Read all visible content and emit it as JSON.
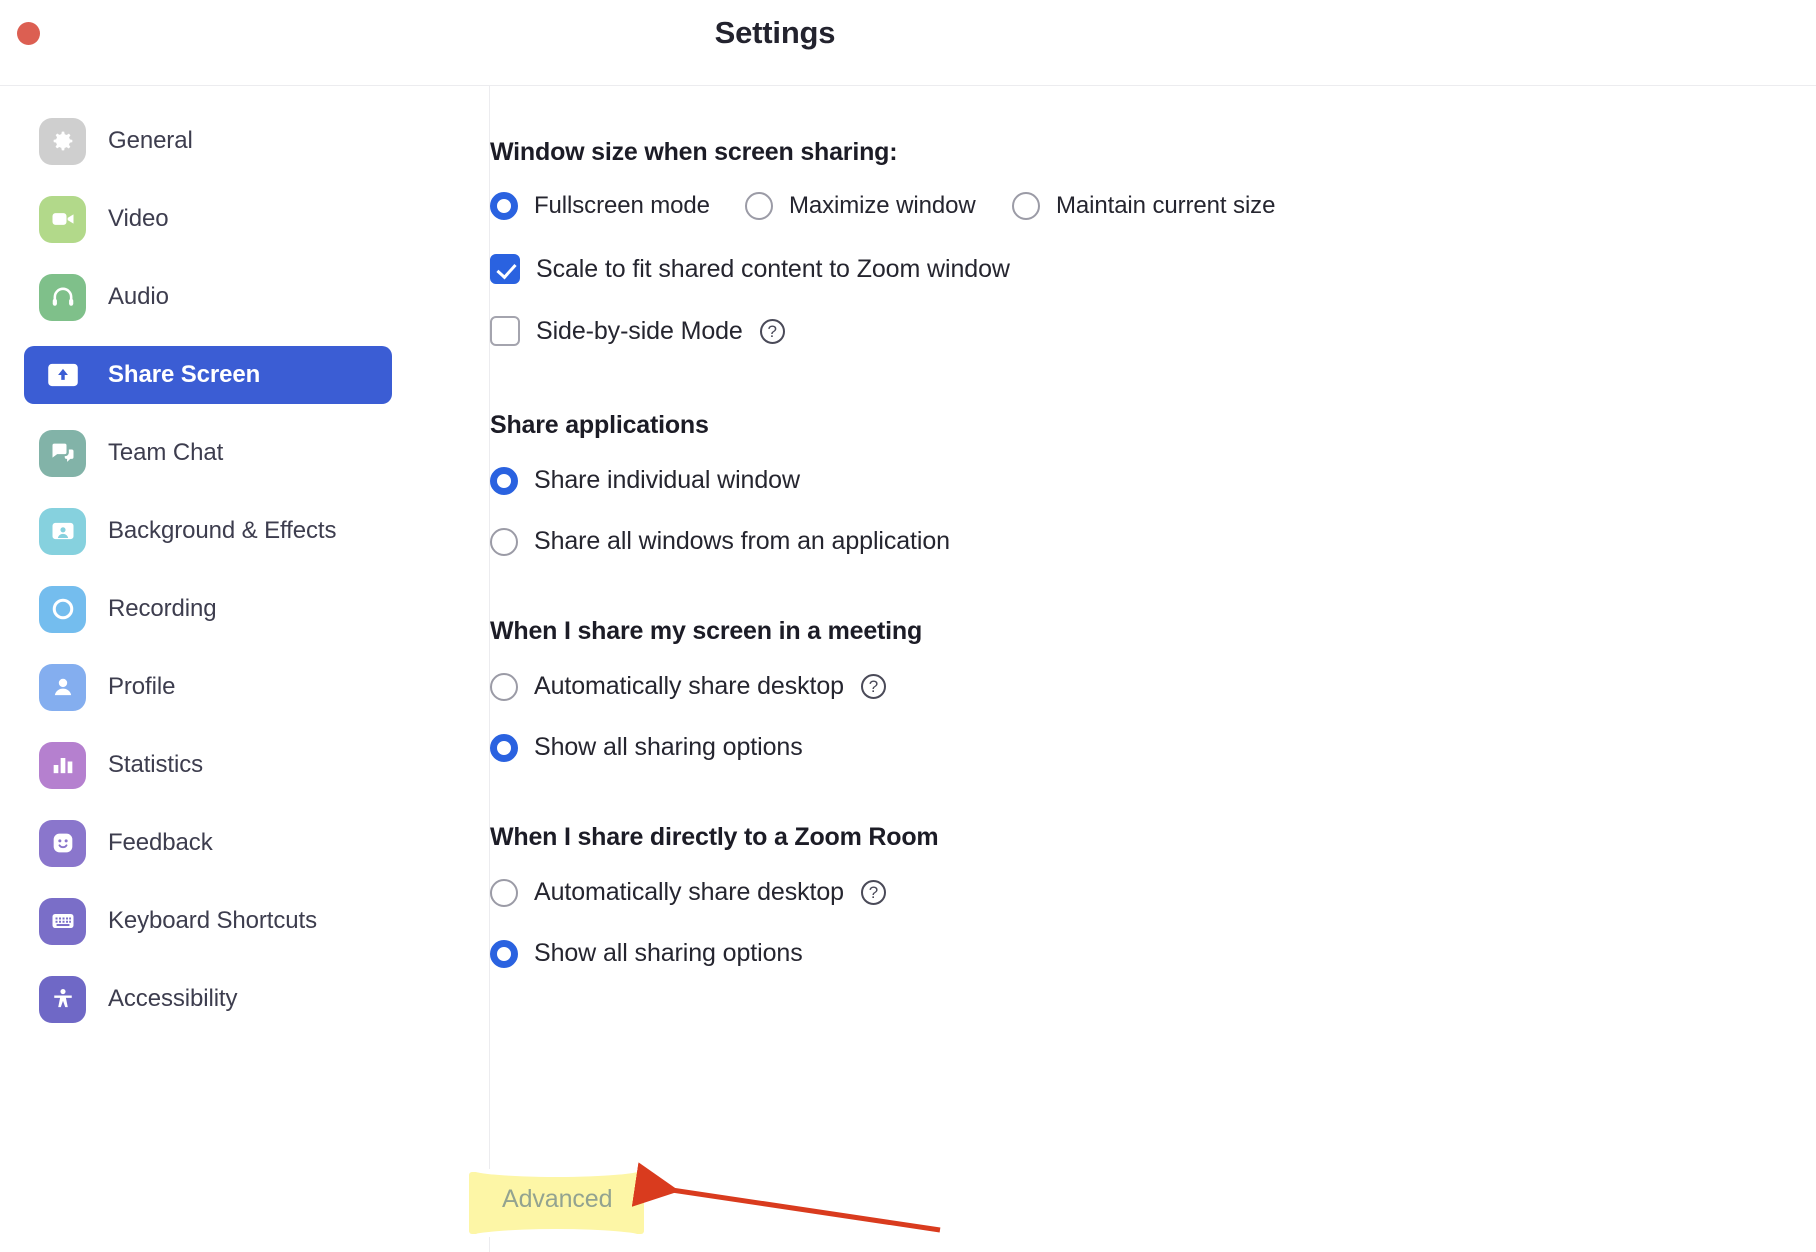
{
  "window": {
    "title": "Settings",
    "close_button_label": "Close",
    "close_color": "#dc5f52"
  },
  "theme": {
    "accent_blue": "#2a62e0",
    "active_nav_blue": "#3b5dd4",
    "highlight_yellow": "#fdf6a6",
    "annotation_red": "#d93b1e",
    "text_dark": "#25252f"
  },
  "sidebar": {
    "items": [
      {
        "label": "General",
        "icon": "gear-icon",
        "color": "#cfcfcf",
        "active": false
      },
      {
        "label": "Video",
        "icon": "video-camera-icon",
        "color": "#b2d98a",
        "active": false
      },
      {
        "label": "Audio",
        "icon": "headphones-icon",
        "color": "#7fc08a",
        "active": false
      },
      {
        "label": "Share Screen",
        "icon": "share-screen-icon",
        "color": "#3b5dd4",
        "active": true
      },
      {
        "label": "Team Chat",
        "icon": "chat-bubble-icon",
        "color": "#82b3a8",
        "active": false
      },
      {
        "label": "Background & Effects",
        "icon": "person-frame-icon",
        "color": "#86d1de",
        "active": false
      },
      {
        "label": "Recording",
        "icon": "record-circle-icon",
        "color": "#74bdee",
        "active": false
      },
      {
        "label": "Profile",
        "icon": "person-icon",
        "color": "#84aeef",
        "active": false
      },
      {
        "label": "Statistics",
        "icon": "bar-chart-icon",
        "color": "#b580cf",
        "active": false
      },
      {
        "label": "Feedback",
        "icon": "smiley-face-icon",
        "color": "#8a76cc",
        "active": false
      },
      {
        "label": "Keyboard Shortcuts",
        "icon": "keyboard-icon",
        "color": "#7a6ec8",
        "active": false
      },
      {
        "label": "Accessibility",
        "icon": "accessibility-icon",
        "color": "#6f68c6",
        "active": false
      }
    ]
  },
  "main": {
    "window_size_section": {
      "heading": "Window size when screen sharing:",
      "radios": [
        {
          "label": "Fullscreen mode",
          "selected": true
        },
        {
          "label": "Maximize window",
          "selected": false
        },
        {
          "label": "Maintain current size",
          "selected": false
        }
      ],
      "checkboxes": [
        {
          "label": "Scale to fit shared content to Zoom window",
          "checked": true,
          "has_help": false
        },
        {
          "label": "Side-by-side Mode",
          "checked": false,
          "has_help": true,
          "help_glyph": "?"
        }
      ]
    },
    "share_applications_section": {
      "heading": "Share applications",
      "radios": [
        {
          "label": "Share individual window",
          "selected": true
        },
        {
          "label": "Share all windows from an application",
          "selected": false
        }
      ]
    },
    "share_in_meeting_section": {
      "heading": "When I share my screen in a meeting",
      "radios": [
        {
          "label": "Automatically share desktop",
          "selected": false,
          "has_help": true,
          "help_glyph": "?"
        },
        {
          "label": "Show all sharing options",
          "selected": true,
          "has_help": false
        }
      ]
    },
    "share_zoom_room_section": {
      "heading": "When I share directly to a Zoom Room",
      "radios": [
        {
          "label": "Automatically share desktop",
          "selected": false,
          "has_help": true,
          "help_glyph": "?"
        },
        {
          "label": "Show all sharing options",
          "selected": true,
          "has_help": false
        }
      ]
    },
    "advanced_button": {
      "label": "Advanced",
      "highlighted": true
    }
  }
}
